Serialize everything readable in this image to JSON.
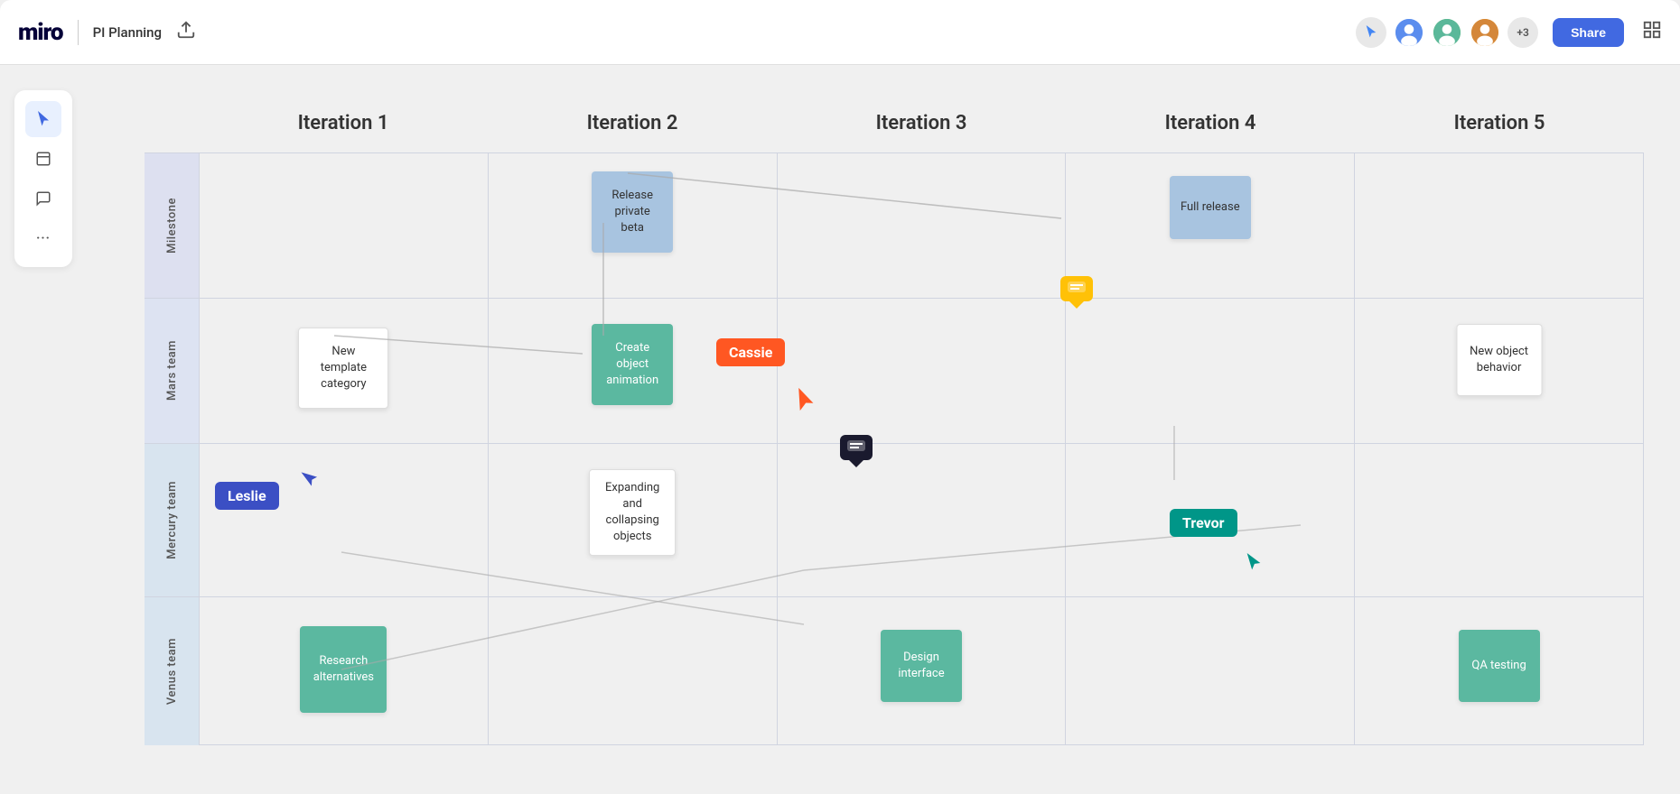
{
  "topbar": {
    "logo": "miro",
    "board_title": "PI Planning",
    "share_label": "Share",
    "more_avatars": "+3"
  },
  "iterations": [
    {
      "label": "Iteration 1"
    },
    {
      "label": "Iteration 2"
    },
    {
      "label": "Iteration 3"
    },
    {
      "label": "Iteration 4"
    },
    {
      "label": "Iteration 5"
    }
  ],
  "rows": [
    {
      "label": "Milestone"
    },
    {
      "label": "Mars team"
    },
    {
      "label": "Mercury team"
    },
    {
      "label": "Venus team"
    }
  ],
  "cards": {
    "release_private_beta": "Release private beta",
    "full_release": "Full release",
    "new_template_category": "New template category",
    "create_object_animation": "Create object animation",
    "new_object_behavior": "New object behavior",
    "expanding_collapsing": "Expanding and collapsing objects",
    "research_alternatives": "Research alternatives",
    "design_interface": "Design interface",
    "qa_testing": "QA testing"
  },
  "users": {
    "cassie": "Cassie",
    "leslie": "Leslie",
    "trevor": "Trevor"
  },
  "sidebar_icons": {
    "cursor": "▲",
    "sticky": "▭",
    "comment": "▬",
    "more": "•••"
  }
}
